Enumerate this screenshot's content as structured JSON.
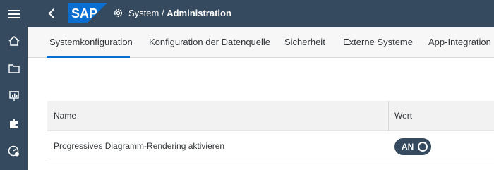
{
  "header": {
    "logo_text": "SAP",
    "title_prefix": "System / ",
    "title_strong": "Administration"
  },
  "sidebar": {
    "items": [
      {
        "icon": "menu-icon"
      },
      {
        "icon": "home-icon"
      },
      {
        "icon": "folder-icon"
      },
      {
        "icon": "presentation-icon"
      },
      {
        "icon": "puzzle-icon"
      },
      {
        "icon": "dashboard-icon"
      }
    ]
  },
  "tabs": [
    {
      "label": "Systemkonfiguration",
      "active": true
    },
    {
      "label": "Konfiguration der Datenquelle",
      "active": false
    },
    {
      "label": "Sicherheit",
      "active": false
    },
    {
      "label": "Externe Systeme",
      "active": false
    },
    {
      "label": "App-Integration",
      "active": false
    }
  ],
  "table": {
    "columns": [
      "Name",
      "Wert"
    ],
    "rows": [
      {
        "name": "Progressives Diagramm-Rendering aktivieren",
        "value": "AN",
        "toggle_on": true
      }
    ]
  },
  "colors": {
    "shell": "#354a5f",
    "accent": "#0a6ed1",
    "sap_blue": "#0a6ed1"
  }
}
